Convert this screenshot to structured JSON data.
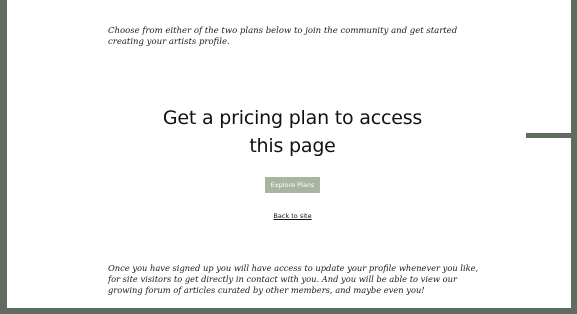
{
  "colors": {
    "frame": "#5f6c5f",
    "button": "#a9b59f"
  },
  "intro": {
    "line1": "Choose from either of the two plans below to join the community and get started",
    "line2": "creating your artists profile."
  },
  "heading": {
    "line1": "Get a pricing plan to access",
    "line2": "this page"
  },
  "explore_button": {
    "label": "Explore Plans"
  },
  "back_link": {
    "label": "Back to site"
  },
  "outro": {
    "line1": "Once you have signed up you will have access to update your profile whenever you like,",
    "line2": "for site visitors to get directly in contact with you. And you will be able to view our",
    "line3": "growing forum of articles curated by other members, and maybe even you!"
  }
}
